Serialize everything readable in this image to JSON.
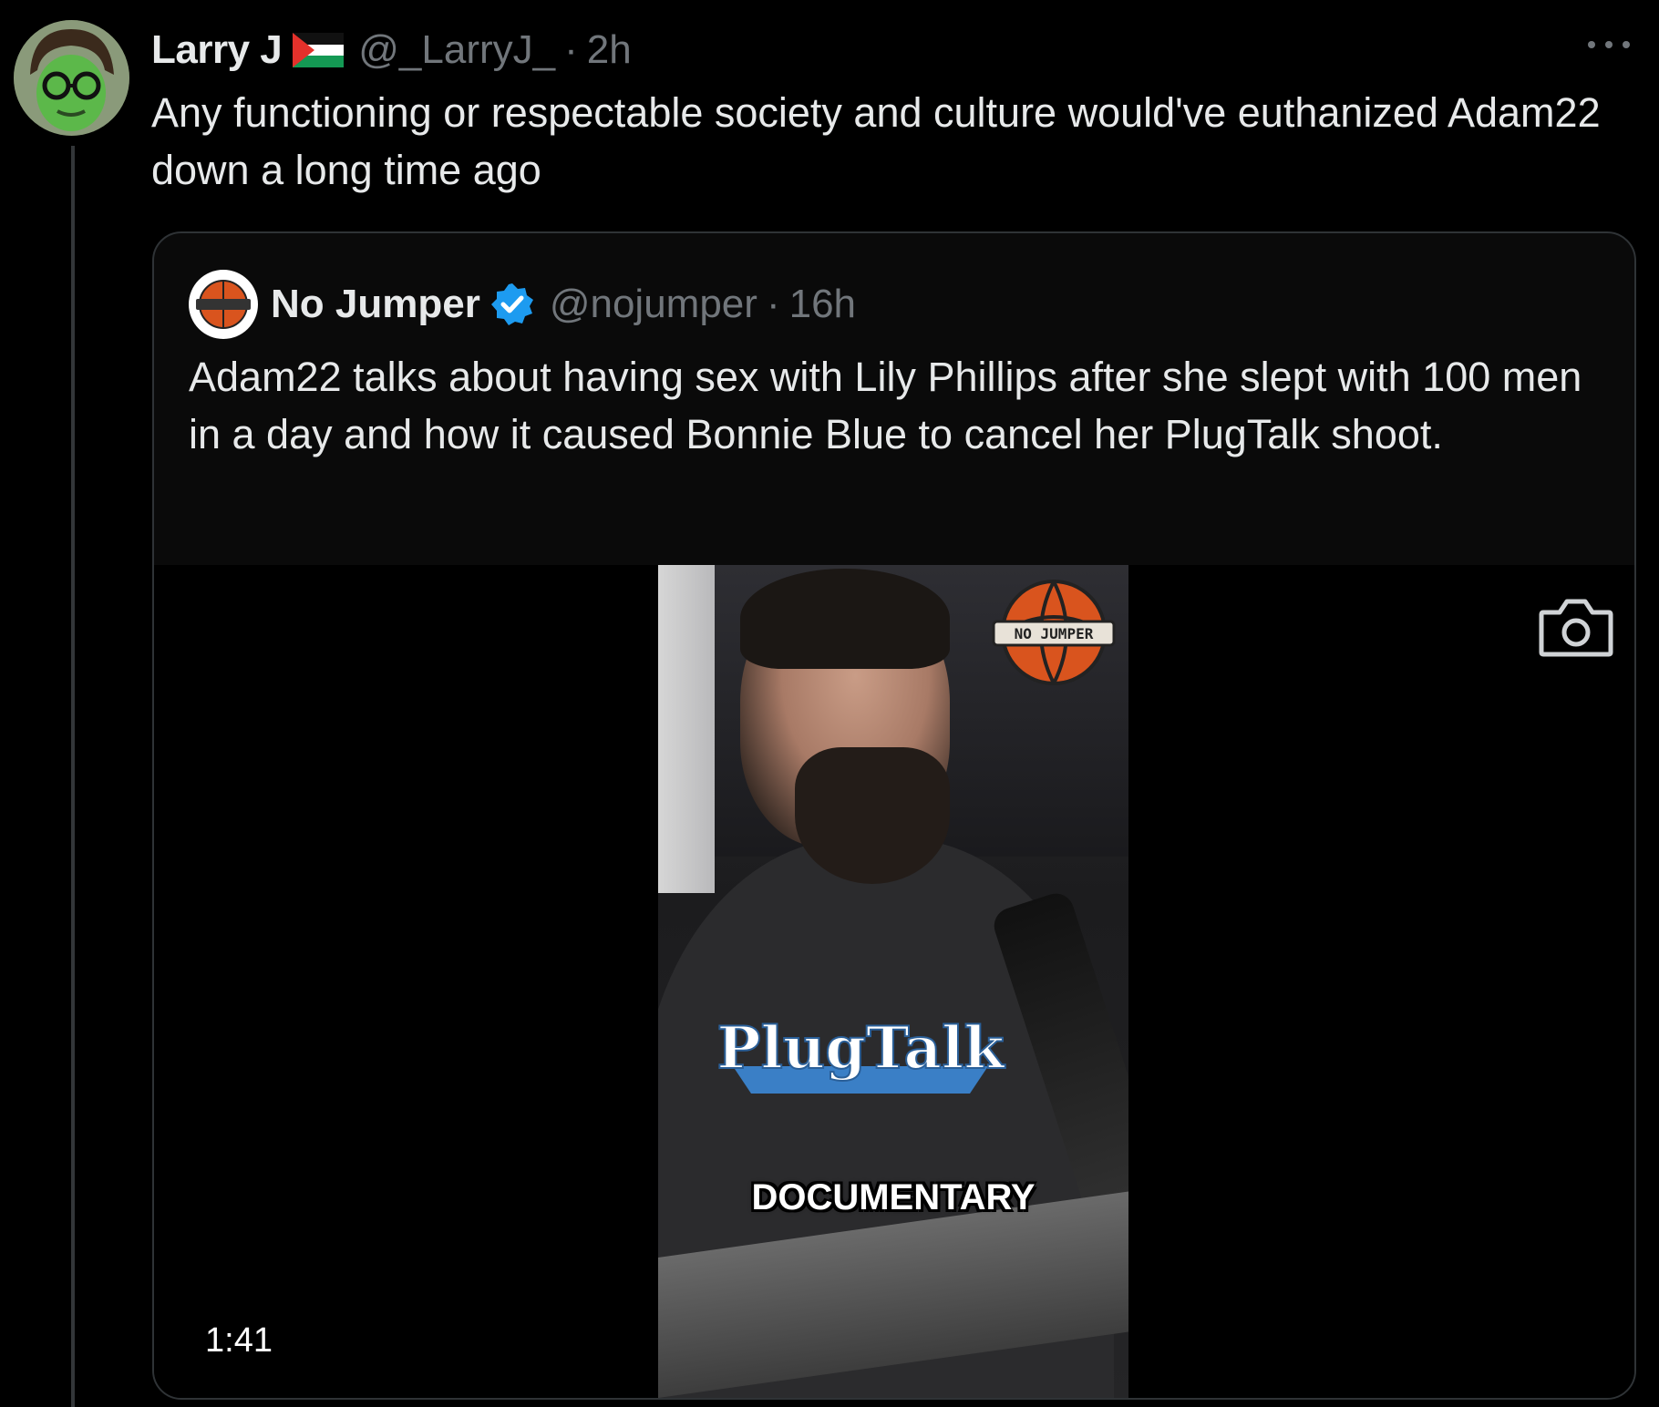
{
  "tweet": {
    "display_name": "Larry J",
    "handle": "@_LarryJ_",
    "separator": "·",
    "time": "2h",
    "text": "Any functioning or respectable society and culture would've euthanized Adam22 down a long time ago",
    "flag_icon": "palestine-flag-icon",
    "more_icon": "more-options-icon"
  },
  "quote": {
    "display_name": "No Jumper",
    "handle": "@nojumper",
    "separator": "·",
    "time": "16h",
    "verified_icon": "verified-badge-icon",
    "text": "Adam22 talks about having sex with Lily Phillips after she slept with 100 men in a day and how it caused Bonnie Blue to cancel her PlugTalk shoot.",
    "media": {
      "duration": "1:41",
      "caption": "DOCUMENTARY",
      "overlay_logo": "NO JUMPER",
      "hoodie_logo": "PlugTalk",
      "camera_icon": "camera-icon"
    }
  },
  "colors": {
    "background": "#000000",
    "text_primary": "#e7e9ea",
    "text_secondary": "#71767b",
    "border": "#2f3336",
    "verified_blue": "#1d9bf0"
  }
}
